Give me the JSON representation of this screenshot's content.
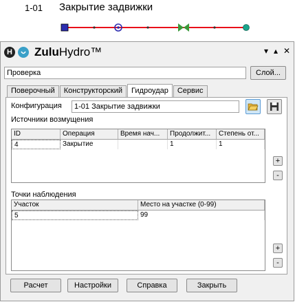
{
  "header": {
    "code": "1-01",
    "title": "Закрытие задвижки"
  },
  "app": {
    "brand_bold": "Zulu",
    "brand_light": "Hydro™",
    "logo_letter": "H"
  },
  "window_controls": {
    "min": "▾",
    "max": "▴",
    "close": "✕"
  },
  "layer": {
    "value": "Проверка",
    "button": "Слой..."
  },
  "tabs": [
    {
      "label": "Поверочный",
      "active": false
    },
    {
      "label": "Конструкторский",
      "active": false
    },
    {
      "label": "Гидроудар",
      "active": true
    },
    {
      "label": "Сервис",
      "active": false
    }
  ],
  "config": {
    "label": "Конфигурация",
    "value": "1-01 Закрытие задвижки"
  },
  "sources": {
    "title": "Источники возмущения",
    "columns": [
      "ID",
      "Операция",
      "Время нач...",
      "Продолжит...",
      "Степень от..."
    ],
    "rows": [
      [
        "4",
        "Закрытие",
        "",
        "1",
        "1"
      ]
    ],
    "add": "+",
    "remove": "-"
  },
  "points": {
    "title": "Точки наблюдения",
    "columns": [
      "Участок",
      "Место на участке (0-99)"
    ],
    "rows": [
      [
        "5",
        "99"
      ]
    ],
    "add": "+",
    "remove": "-"
  },
  "buttons": {
    "calc": "Расчет",
    "settings": "Настройки",
    "help": "Справка",
    "close": "Закрыть"
  },
  "colors": {
    "pipe": "#e8101a",
    "accent_blue": "#2d2db0",
    "teal": "#1aa58c",
    "valve_green": "#3a9a3a"
  }
}
